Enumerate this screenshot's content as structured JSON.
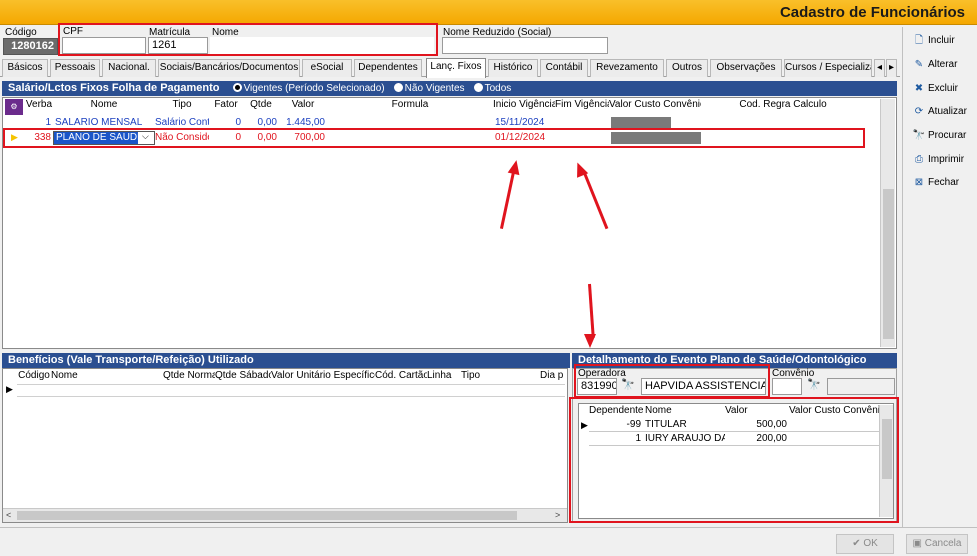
{
  "window": {
    "title": "Cadastro de Funcionários"
  },
  "header": {
    "codigo_label": "Código",
    "codigo_value": "1280162",
    "cpf_label": "CPF",
    "cpf_value": "",
    "matricula_label": "Matrícula",
    "matricula_value": "1261",
    "nome_label": "Nome",
    "nome_value": "",
    "nome_reduzido_label": "Nome Reduzido (Social)",
    "nome_reduzido_value": ""
  },
  "tabs": [
    "Básicos",
    "Pessoais",
    "Nacional.",
    "Sociais/Bancários/Documentos",
    "eSocial",
    "Dependentes",
    "Lanç. Fixos",
    "Histórico",
    "Contábil",
    "Revezamento",
    "Outros",
    "Observações",
    "Cursos / Especializa"
  ],
  "active_tab": "Lanç. Fixos",
  "salario_section": {
    "title": "Salário/Lctos Fixos Folha de Pagamento",
    "radio_vigentes": "Vigentes (Período Selecionado)",
    "radio_nao_vigentes": "Não Vigentes",
    "radio_todos": "Todos",
    "columns": [
      "Verba",
      "Nome",
      "Tipo",
      "Fator",
      "Qtde",
      "Valor",
      "Formula",
      "Inicio Vigência",
      "Fim Vigência",
      "Valor Custo Convênio",
      "Cod. Regra Calculo"
    ],
    "rows": [
      {
        "verba": "1",
        "nome": "SALARIO MENSAL",
        "tipo": "Salário Contr",
        "fator": "0",
        "qtde": "0,00",
        "valor": "1.445,00",
        "formula": "",
        "inicio": "15/11/2024",
        "fim": "",
        "custo": "",
        "regra": ""
      },
      {
        "verba": "338",
        "nome": "PLANO DE SAUDE",
        "tipo": "Não Conside",
        "fator": "0",
        "qtde": "0,00",
        "valor": "700,00",
        "formula": "",
        "inicio": "01/12/2024",
        "fim": "",
        "custo": "",
        "regra": ""
      }
    ]
  },
  "beneficios_section": {
    "title": "Benefícios (Vale Transporte/Refeição) Utilizado",
    "columns": [
      "Código",
      "Nome",
      "Qtde Normal",
      "Qtde Sábado",
      "Valor Unitário Específico",
      "Cód. Cartão",
      "Linha",
      "Tipo",
      "Dia p"
    ]
  },
  "plano_section": {
    "title": "Detalhamento do Evento Plano de Saúde/Odontológico",
    "operadora_label": "Operadora",
    "operadora_code": "831990",
    "operadora_name": "HAPVIDA ASSISTENCIA ME",
    "convenio_label": "Convênio",
    "columns": [
      "Dependente",
      "Nome",
      "Valor",
      "Valor Custo Convênio"
    ],
    "rows": [
      {
        "dependente": "-99",
        "nome": "TITULAR",
        "valor": "500,00",
        "custo": ""
      },
      {
        "dependente": "1",
        "nome": "IURY ARAUJO DA",
        "valor": "200,00",
        "custo": ""
      }
    ]
  },
  "side_buttons": [
    {
      "key": "incluir",
      "label": "Incluir",
      "icon": "document-new-icon"
    },
    {
      "key": "alterar",
      "label": "Alterar",
      "icon": "pencil-icon"
    },
    {
      "key": "excluir",
      "label": "Excluir",
      "icon": "delete-icon"
    },
    {
      "key": "atualizar",
      "label": "Atualizar",
      "icon": "refresh-icon"
    },
    {
      "key": "procurar",
      "label": "Procurar",
      "icon": "binoculars-icon"
    },
    {
      "key": "imprimir",
      "label": "Imprimir",
      "icon": "printer-icon"
    },
    {
      "key": "fechar",
      "label": "Fechar",
      "icon": "close-window-icon"
    }
  ],
  "footer": {
    "ok_label": "OK",
    "cancela_label": "Cancela"
  },
  "colors": {
    "accent_title_bar": "#f5a800",
    "section_bar": "#2b4f91",
    "annotation_red": "#e0141e",
    "selected_row_text": "#e0141e",
    "link_blue": "#1b3fbf"
  }
}
